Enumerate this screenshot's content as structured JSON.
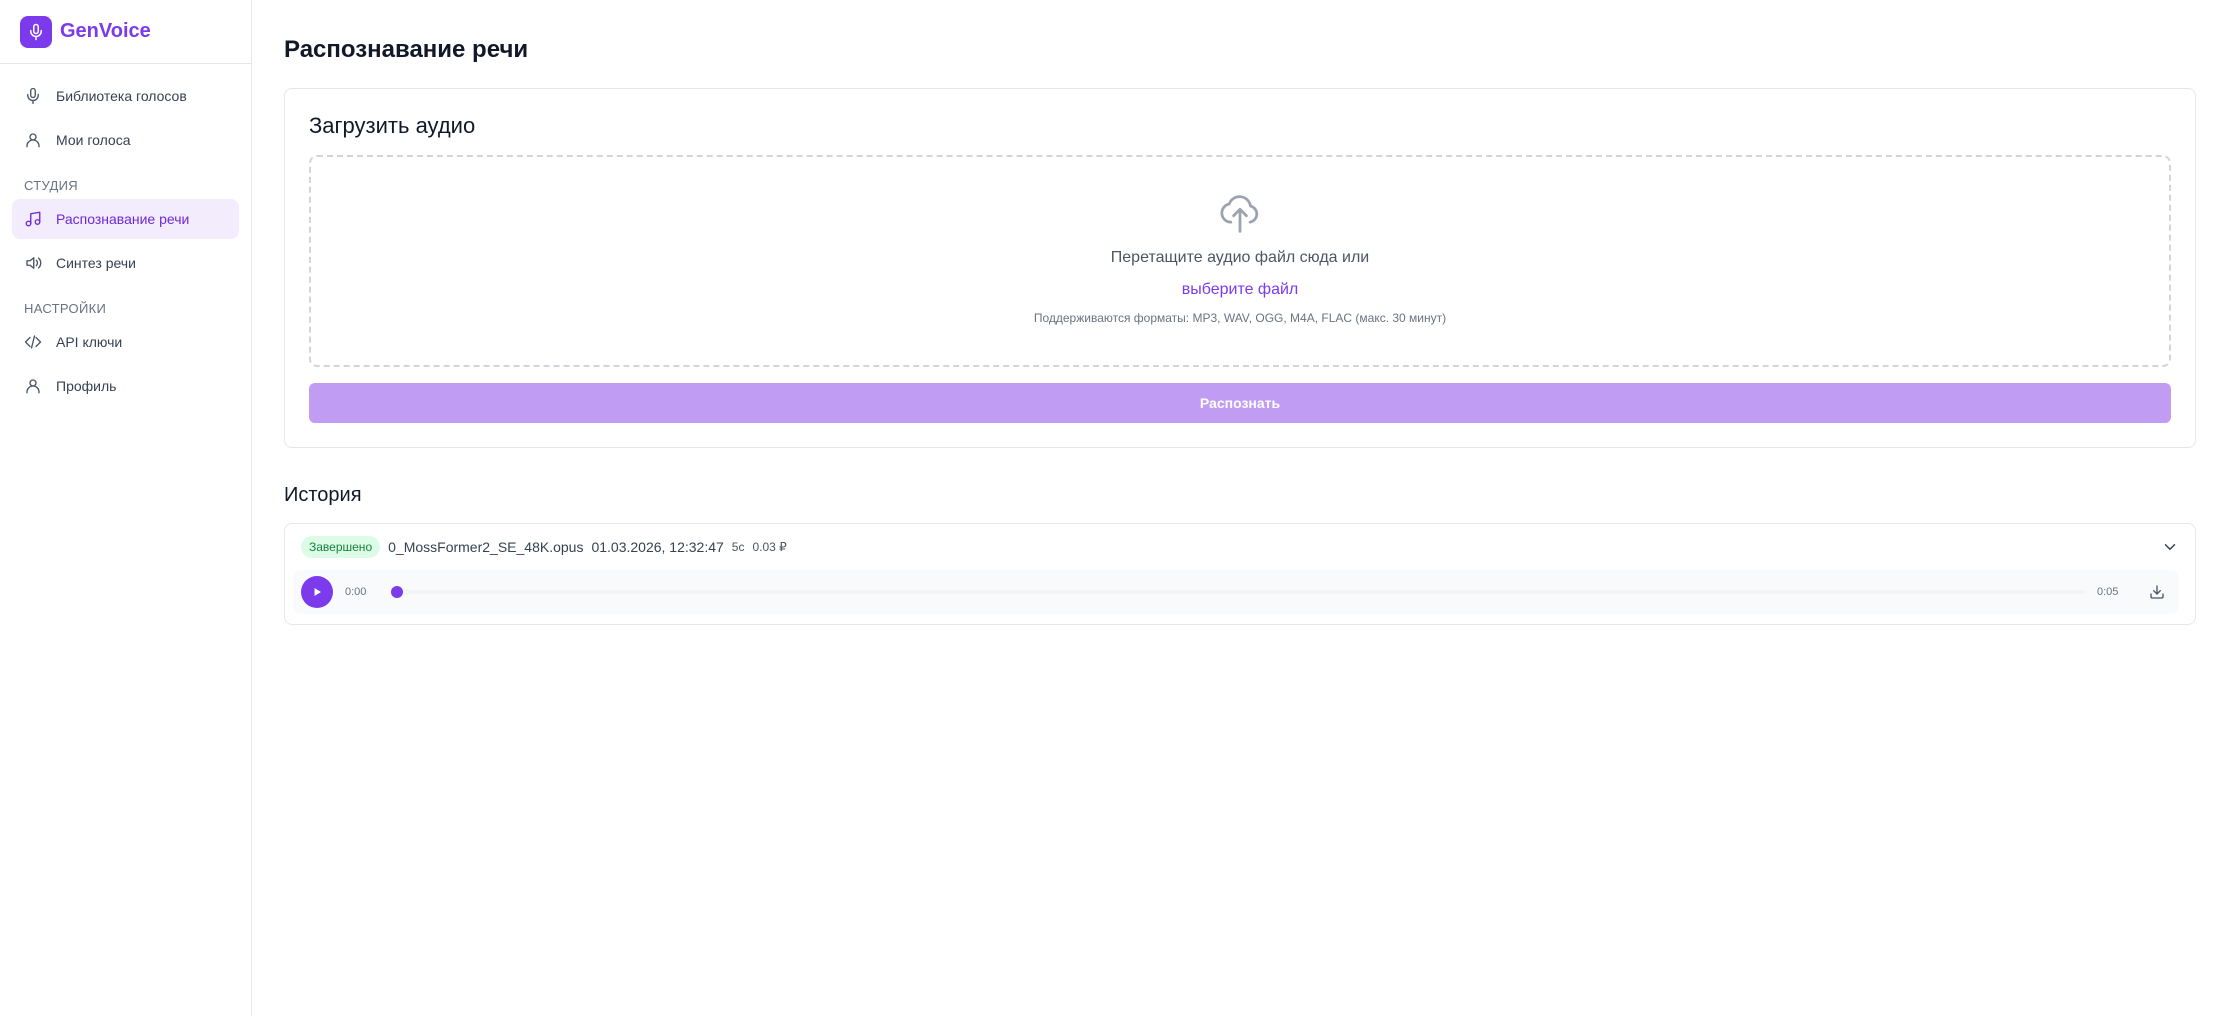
{
  "brand": {
    "name": "GenVoice"
  },
  "sidebar": {
    "items_top": [
      {
        "label": "Библиотека голосов",
        "icon": "microphone-icon"
      },
      {
        "label": "Мои голоса",
        "icon": "user-icon"
      }
    ],
    "studio_section": "СТУДИЯ",
    "studio_items": [
      {
        "label": "Распознавание речи",
        "icon": "music-note-icon",
        "active": true
      },
      {
        "label": "Синтез речи",
        "icon": "speaker-icon"
      }
    ],
    "settings_section": "НАСТРОЙКИ",
    "settings_items": [
      {
        "label": "API ключи",
        "icon": "code-icon"
      },
      {
        "label": "Профиль",
        "icon": "user-icon"
      }
    ]
  },
  "page": {
    "title": "Распознавание речи"
  },
  "upload": {
    "title": "Загрузить аудио",
    "drop_text": "Перетащите аудио файл сюда или",
    "choose_link": "выберите файл",
    "formats": "Поддерживаются форматы: MP3, WAV, OGG, M4A, FLAC (макс. 30 минут)",
    "submit_label": "Распознать"
  },
  "history": {
    "title": "История",
    "items": [
      {
        "status": "Завершено",
        "filename": "0_MossFormer2_SE_48K.opus",
        "date": "01.03.2026, 12:32:47",
        "duration": "5с",
        "cost": "0.03 ₽",
        "player": {
          "current": "0:00",
          "total": "0:05",
          "progress": 0.0
        }
      }
    ]
  },
  "colors": {
    "accent": "#7c3aed",
    "active_bg": "#f3ecfd",
    "button_disabled": "#c09df2",
    "status_bg": "#dcfce7",
    "status_text": "#15803d"
  }
}
